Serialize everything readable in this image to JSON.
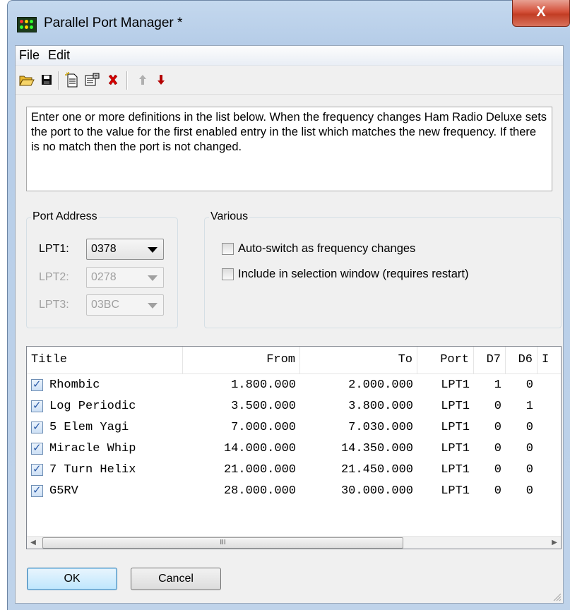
{
  "window": {
    "title": "Parallel Port Manager *",
    "close_label": "X"
  },
  "menu": {
    "items": [
      "File",
      "Edit"
    ]
  },
  "toolbar": {
    "buttons": [
      "open-icon",
      "save-icon",
      "new-icon",
      "properties-icon",
      "delete-icon",
      "move-up-icon",
      "move-down-icon"
    ]
  },
  "description": "Enter one or more definitions in the list below. When the frequency changes Ham Radio Deluxe sets the port to the value for the first enabled entry in the list which matches the new frequency. If there is no match then the port is not changed.",
  "port_address": {
    "legend": "Port Address",
    "ports": [
      {
        "label": "LPT1:",
        "value": "0378",
        "enabled": true
      },
      {
        "label": "LPT2:",
        "value": "0278",
        "enabled": false
      },
      {
        "label": "LPT3:",
        "value": "03BC",
        "enabled": false
      }
    ]
  },
  "various": {
    "legend": "Various",
    "options": [
      {
        "label": "Auto-switch as frequency changes",
        "checked": false
      },
      {
        "label": "Include in selection window (requires restart)",
        "checked": false
      }
    ]
  },
  "list": {
    "columns": [
      "Title",
      "From",
      "To",
      "Port",
      "D7",
      "D6",
      "I"
    ],
    "rows": [
      {
        "checked": true,
        "title": "Rhombic",
        "from": "1.800.000",
        "to": "2.000.000",
        "port": "LPT1",
        "d7": "1",
        "d6": "0"
      },
      {
        "checked": true,
        "title": "Log Periodic",
        "from": "3.500.000",
        "to": "3.800.000",
        "port": "LPT1",
        "d7": "0",
        "d6": "1"
      },
      {
        "checked": true,
        "title": "5 Elem Yagi",
        "from": "7.000.000",
        "to": "7.030.000",
        "port": "LPT1",
        "d7": "0",
        "d6": "0"
      },
      {
        "checked": true,
        "title": "Miracle Whip",
        "from": "14.000.000",
        "to": "14.350.000",
        "port": "LPT1",
        "d7": "0",
        "d6": "0"
      },
      {
        "checked": true,
        "title": "7 Turn Helix",
        "from": "21.000.000",
        "to": "21.450.000",
        "port": "LPT1",
        "d7": "0",
        "d6": "0"
      },
      {
        "checked": true,
        "title": "G5RV",
        "from": "28.000.000",
        "to": "30.000.000",
        "port": "LPT1",
        "d7": "0",
        "d6": "0"
      }
    ],
    "scroll_thumb_label": "III"
  },
  "buttons": {
    "ok": "OK",
    "cancel": "Cancel"
  },
  "colors": {
    "accent": "#3c7fb1",
    "delete": "#d40000",
    "move_down": "#b40000"
  }
}
